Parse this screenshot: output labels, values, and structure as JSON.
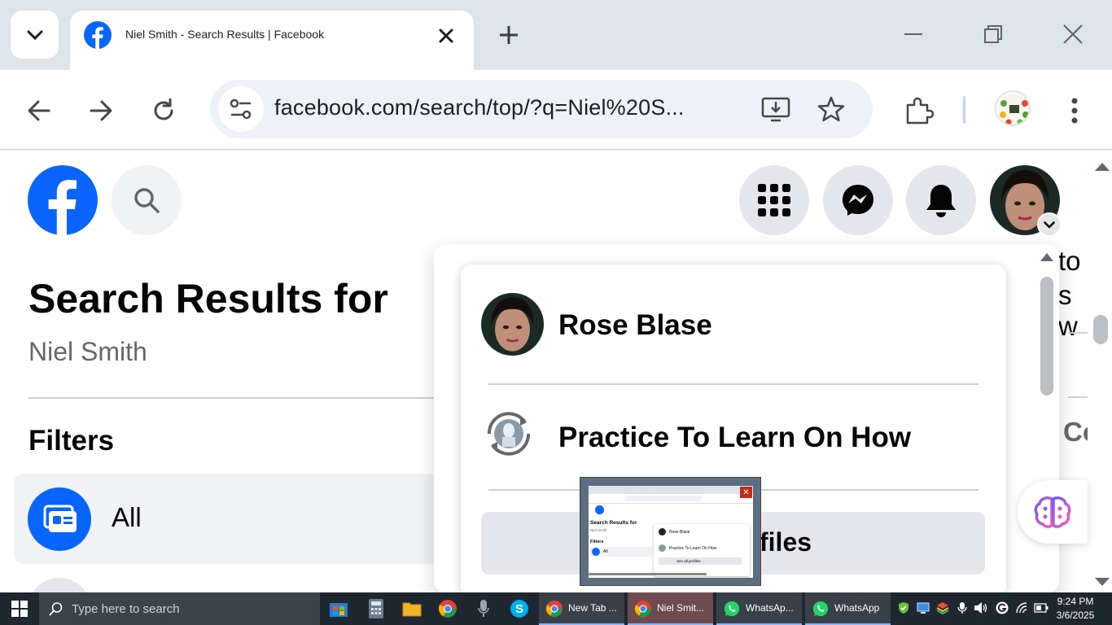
{
  "browser": {
    "tab": {
      "title": "Niel Smith - Search Results | Facebook"
    },
    "address_bar": {
      "url": "facebook.com/search/top/?q=Niel%20S..."
    }
  },
  "facebook": {
    "search_results": {
      "heading": "Search Results for",
      "query": "Niel Smith"
    },
    "filters": {
      "heading": "Filters",
      "items": [
        {
          "label": "All",
          "selected": true
        }
      ]
    },
    "right_peek": {
      "line1": "to",
      "line2": "s w",
      "line3": "Co"
    },
    "account_menu": {
      "profile_name": "Rose Blase",
      "page_name": "Practice To Learn On How",
      "see_all_label": "rofiles"
    }
  },
  "thumbnail_preview": {
    "heading": "Search Results for",
    "query": "Niel Smith",
    "filters": "Filters",
    "all": "All",
    "profile_name": "Rose Blase",
    "page_name": "Practice To Learn On How",
    "see_all": "See all profiles"
  },
  "taskbar": {
    "search_placeholder": "Type here to search",
    "tasks": [
      {
        "label": "New Tab ..."
      },
      {
        "label": "Niel Smit..."
      },
      {
        "label": "WhatsAp..."
      },
      {
        "label": "WhatsApp"
      }
    ],
    "clock": {
      "time": "9:24 PM",
      "date": "3/6/2025"
    }
  },
  "colors": {
    "facebook_blue": "#0866ff",
    "messenger_gradient": [
      "#0866ff",
      "#a033ff",
      "#ff5c87"
    ],
    "taskbar": "#1f2731",
    "active_task": "#6d4c4f"
  }
}
